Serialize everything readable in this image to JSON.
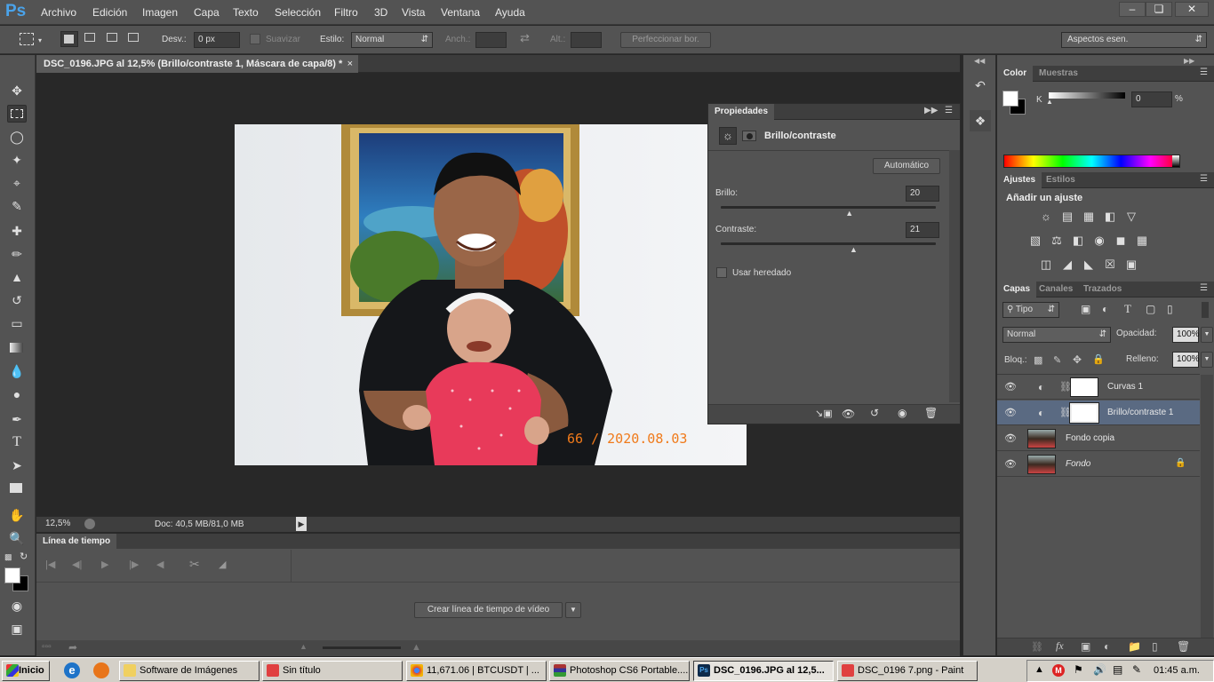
{
  "app": {
    "logo": "Ps"
  },
  "menu": [
    "Archivo",
    "Edición",
    "Imagen",
    "Capa",
    "Texto",
    "Selección",
    "Filtro",
    "3D",
    "Vista",
    "Ventana",
    "Ayuda"
  ],
  "options": {
    "desv_label": "Desv.:",
    "desv_value": "0 px",
    "suavizar": "Suavizar",
    "estilo_label": "Estilo:",
    "estilo_value": "Normal",
    "anch_label": "Anch.:",
    "alt_label": "Alt.:",
    "perfeccionar": "Perfeccionar bor.",
    "workspace": "Aspectos esen."
  },
  "document": {
    "tab_title": "DSC_0196.JPG al 12,5% (Brillo/contraste 1, Máscara de capa/8) *",
    "photo_stamp": "66 / 2020.08.03",
    "zoom": "12,5%",
    "doc_info": "Doc: 40,5 MB/81,0 MB"
  },
  "properties": {
    "tab": "Propiedades",
    "title": "Brillo/contraste",
    "auto_button": "Automático",
    "brillo_label": "Brillo:",
    "brillo_value": "20",
    "brillo_level": 0.6,
    "contraste_label": "Contraste:",
    "contraste_value": "21",
    "contraste_level": 0.62,
    "legacy_label": "Usar heredado"
  },
  "timeline": {
    "tab": "Línea de tiempo",
    "create_button": "Crear línea de tiempo de vídeo"
  },
  "color_panel": {
    "tabs": [
      "Color",
      "Muestras"
    ],
    "channel": "K",
    "value": "0",
    "unit": "%"
  },
  "adjust_panel": {
    "tabs": [
      "Ajustes",
      "Estilos"
    ],
    "title": "Añadir un ajuste"
  },
  "layers_panel": {
    "tabs": [
      "Capas",
      "Canales",
      "Trazados"
    ],
    "filter": "Tipo",
    "blend": "Normal",
    "opacity_label": "Opacidad:",
    "opacity_value": "100%",
    "lock_label": "Bloq.:",
    "fill_label": "Relleno:",
    "fill_value": "100%",
    "layers": [
      {
        "name": "Curvas 1"
      },
      {
        "name": "Brillo/contraste 1"
      },
      {
        "name": "Fondo copia"
      },
      {
        "name": "Fondo"
      }
    ]
  },
  "taskbar": {
    "start": "Inicio",
    "tasks": [
      "Software de Imágenes",
      "Sin título",
      "11,671.06 | BTCUSDT | ...",
      "Photoshop CS6 Portable....",
      "DSC_0196.JPG al 12,5...",
      "DSC_0196 7.png - Paint"
    ],
    "clock": "01:45 a.m."
  },
  "colors": {
    "accent": "#4aa3ea",
    "selected_layer": "#5a6a82",
    "stamp": "#f07a1a"
  }
}
